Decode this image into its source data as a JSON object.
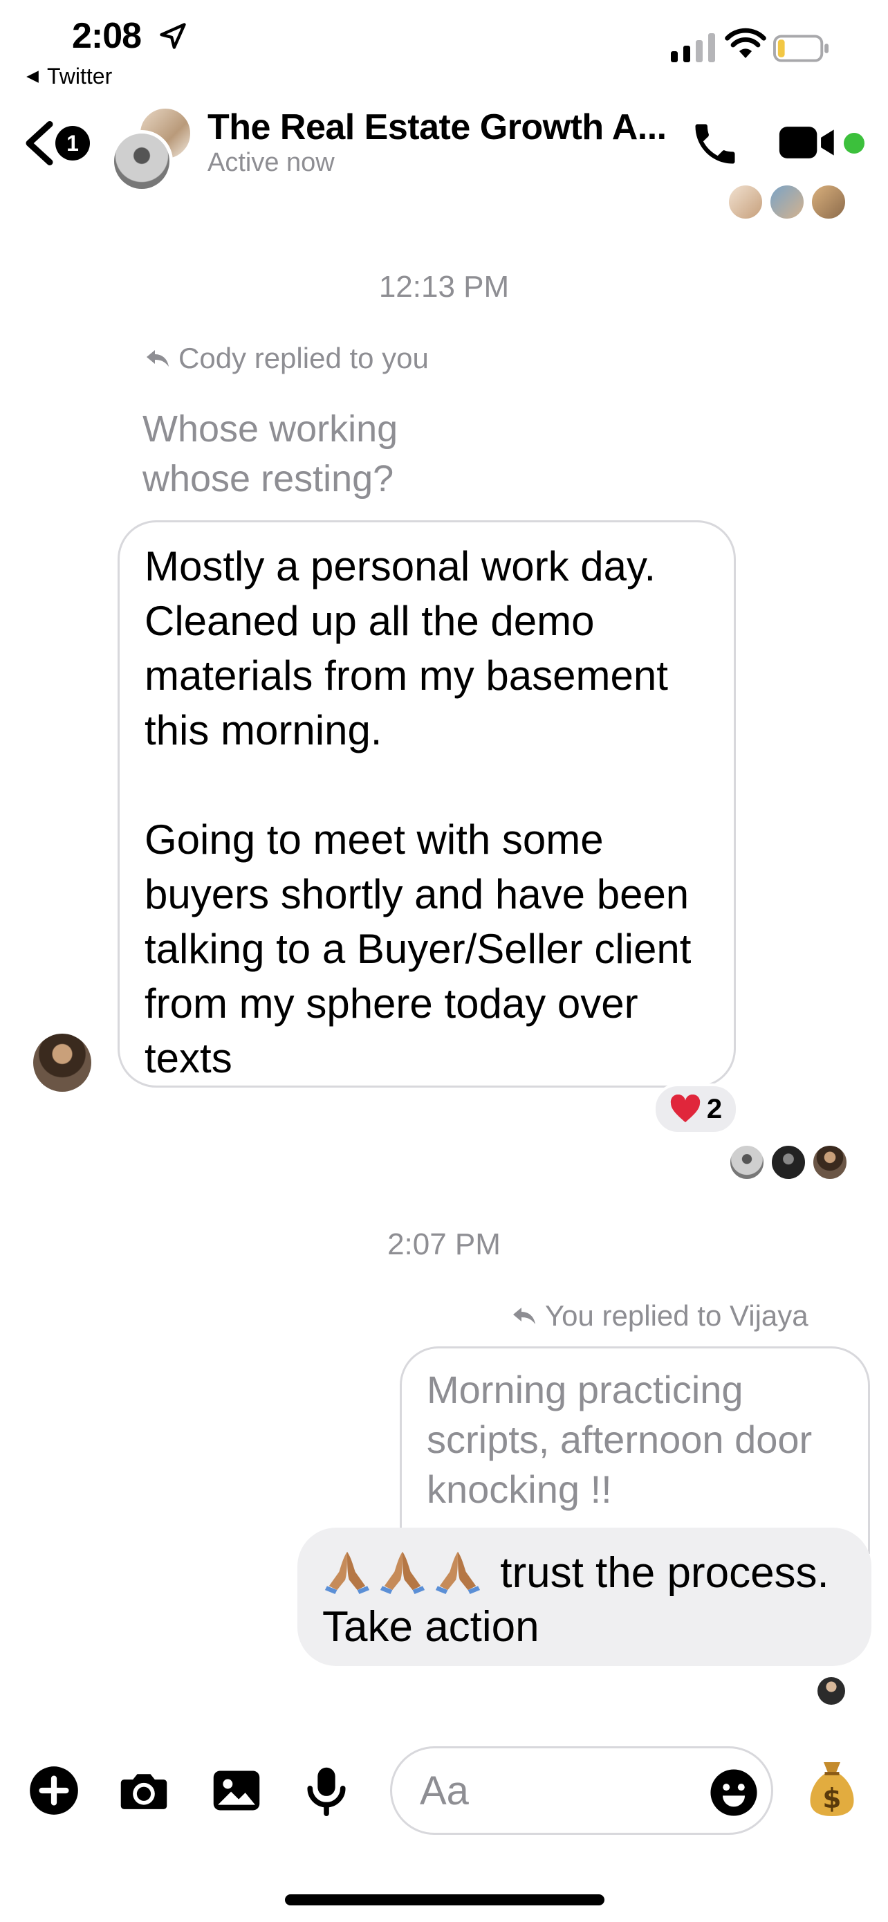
{
  "status_bar": {
    "time": "2:08",
    "back_app": "Twitter"
  },
  "header": {
    "back_badge": "1",
    "title": "The Real Estate Growth A...",
    "subtitle": "Active now"
  },
  "thread": {
    "timestamp_1": "12:13 PM",
    "reply_label_1": "Cody replied to you",
    "quoted_1": [
      "Whose working",
      "whose resting?"
    ],
    "message_1": {
      "paragraph_1": "Mostly a personal work day. Cleaned up all the demo materials from my basement this morning.",
      "paragraph_2": "Going to meet with some buyers shortly and have been talking to a Buyer/Seller client from my sphere today over texts"
    },
    "reaction_count": "2",
    "timestamp_2": "2:07 PM",
    "reply_label_2": "You replied to Vijaya",
    "quoted_2": "Morning practicing scripts, afternoon door knocking !!",
    "message_2_text": "trust the process. Take action"
  },
  "composer": {
    "placeholder": "Aa"
  },
  "colors": {
    "active": "#3cc03c",
    "secondary_text": "#8e8e93",
    "bubble_gray": "#efeff1"
  }
}
